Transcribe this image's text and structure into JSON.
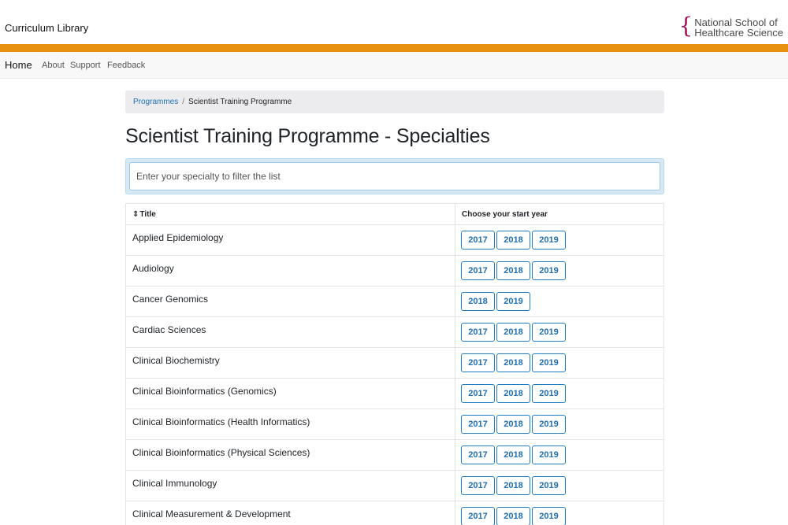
{
  "header": {
    "app_title": "Curriculum Library",
    "logo_line1": "National School of",
    "logo_line2": "Healthcare Science",
    "logo_brace": "{",
    "accent_color": "#e8900f",
    "brand_color": "#a3105a"
  },
  "nav": {
    "home": "Home",
    "links": [
      "About",
      "Support",
      "Feedback"
    ]
  },
  "breadcrumb": {
    "link": "Programmes",
    "separator": "/",
    "current": "Scientist Training Programme"
  },
  "page_title": "Scientist Training Programme - Specialties",
  "search": {
    "placeholder": "Enter your specialty to filter the list",
    "value": ""
  },
  "table": {
    "sort_icon": "sort-icon",
    "col_title": "Title",
    "col_years": "Choose your start year",
    "rows": [
      {
        "title": "Applied Epidemiology",
        "years": [
          "2017",
          "2018",
          "2019"
        ]
      },
      {
        "title": "Audiology",
        "years": [
          "2017",
          "2018",
          "2019"
        ]
      },
      {
        "title": "Cancer Genomics",
        "years": [
          "2018",
          "2019"
        ]
      },
      {
        "title": "Cardiac Sciences",
        "years": [
          "2017",
          "2018",
          "2019"
        ]
      },
      {
        "title": "Clinical Biochemistry",
        "years": [
          "2017",
          "2018",
          "2019"
        ]
      },
      {
        "title": "Clinical Bioinformatics (Genomics)",
        "years": [
          "2017",
          "2018",
          "2019"
        ]
      },
      {
        "title": "Clinical Bioinformatics (Health Informatics)",
        "years": [
          "2017",
          "2018",
          "2019"
        ]
      },
      {
        "title": "Clinical Bioinformatics (Physical Sciences)",
        "years": [
          "2017",
          "2018",
          "2019"
        ]
      },
      {
        "title": "Clinical Immunology",
        "years": [
          "2017",
          "2018",
          "2019"
        ]
      },
      {
        "title": "Clinical Measurement & Development",
        "years": [
          "2017",
          "2018",
          "2019"
        ]
      }
    ]
  }
}
